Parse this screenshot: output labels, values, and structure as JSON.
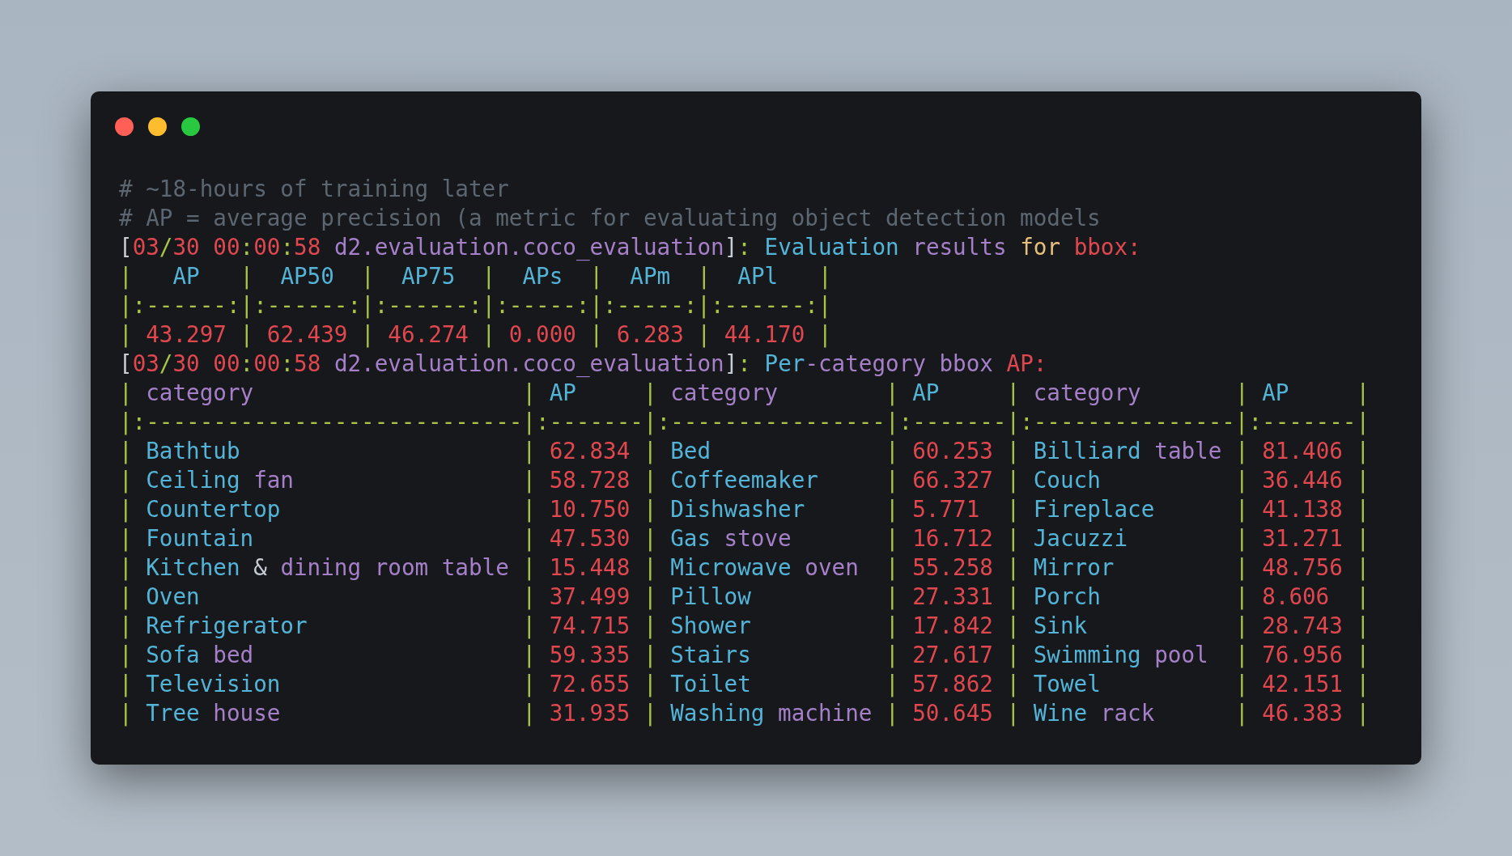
{
  "window": {
    "controls": [
      {
        "color": "#ff5f57"
      },
      {
        "color": "#febc2e"
      },
      {
        "color": "#28c840"
      }
    ]
  },
  "lines": [
    {
      "tokens": [
        {
          "text": "# ~18-hours of training later",
          "color": "#5c6671"
        }
      ]
    },
    {
      "tokens": [
        {
          "text": "# AP = average precision (a metric for evaluating object detection models",
          "color": "#5c6671"
        }
      ]
    },
    {
      "tokens": [
        {
          "text": "[",
          "color": "#c8ccd4"
        },
        {
          "text": "03",
          "color": "#e0474f"
        },
        {
          "text": "/",
          "color": "#a8c545"
        },
        {
          "text": "30 00",
          "color": "#e0474f"
        },
        {
          "text": ":",
          "color": "#a8c545"
        },
        {
          "text": "00",
          "color": "#e0474f"
        },
        {
          "text": ":",
          "color": "#a8c545"
        },
        {
          "text": "58",
          "color": "#e0474f"
        },
        {
          "text": " d2.evaluation.coco_evaluation",
          "color": "#a57fc8"
        },
        {
          "text": "]",
          "color": "#c8ccd4"
        },
        {
          "text": ": ",
          "color": "#a8c545"
        },
        {
          "text": "Evaluation",
          "color": "#53b4d8"
        },
        {
          "text": " results",
          "color": "#a57fc8"
        },
        {
          "text": " for",
          "color": "#e5c07b"
        },
        {
          "text": " bbox:",
          "color": "#e0474f"
        }
      ]
    },
    {
      "tokens": [
        {
          "text": "|   ",
          "color": "#a8c545"
        },
        {
          "text": "AP",
          "color": "#53b4d8"
        },
        {
          "text": "   |  ",
          "color": "#a8c545"
        },
        {
          "text": "AP50",
          "color": "#53b4d8"
        },
        {
          "text": "  |  ",
          "color": "#a8c545"
        },
        {
          "text": "AP75",
          "color": "#53b4d8"
        },
        {
          "text": "  |  ",
          "color": "#a8c545"
        },
        {
          "text": "APs",
          "color": "#53b4d8"
        },
        {
          "text": "  |  ",
          "color": "#a8c545"
        },
        {
          "text": "APm",
          "color": "#53b4d8"
        },
        {
          "text": "  |  ",
          "color": "#a8c545"
        },
        {
          "text": "APl",
          "color": "#53b4d8"
        },
        {
          "text": "   |",
          "color": "#a8c545"
        }
      ]
    },
    {
      "tokens": [
        {
          "text": "|:------:|:------:|:------:|:-----:|:-----:|:------:|",
          "color": "#a8c545"
        }
      ]
    },
    {
      "tokens": [
        {
          "text": "| ",
          "color": "#a8c545"
        },
        {
          "text": "43.297",
          "color": "#e0474f"
        },
        {
          "text": " | ",
          "color": "#a8c545"
        },
        {
          "text": "62.439",
          "color": "#e0474f"
        },
        {
          "text": " | ",
          "color": "#a8c545"
        },
        {
          "text": "46.274",
          "color": "#e0474f"
        },
        {
          "text": " | ",
          "color": "#a8c545"
        },
        {
          "text": "0.000",
          "color": "#e0474f"
        },
        {
          "text": " | ",
          "color": "#a8c545"
        },
        {
          "text": "6.283",
          "color": "#e0474f"
        },
        {
          "text": " | ",
          "color": "#a8c545"
        },
        {
          "text": "44.170",
          "color": "#e0474f"
        },
        {
          "text": " |",
          "color": "#a8c545"
        }
      ]
    },
    {
      "tokens": [
        {
          "text": "[",
          "color": "#c8ccd4"
        },
        {
          "text": "03",
          "color": "#e0474f"
        },
        {
          "text": "/",
          "color": "#a8c545"
        },
        {
          "text": "30 00",
          "color": "#e0474f"
        },
        {
          "text": ":",
          "color": "#a8c545"
        },
        {
          "text": "00",
          "color": "#e0474f"
        },
        {
          "text": ":",
          "color": "#a8c545"
        },
        {
          "text": "58",
          "color": "#e0474f"
        },
        {
          "text": " d2.evaluation.coco_evaluation",
          "color": "#a57fc8"
        },
        {
          "text": "]",
          "color": "#c8ccd4"
        },
        {
          "text": ": ",
          "color": "#a8c545"
        },
        {
          "text": "Per",
          "color": "#53b4d8"
        },
        {
          "text": "-category bbox",
          "color": "#a57fc8"
        },
        {
          "text": " AP:",
          "color": "#e0474f"
        }
      ]
    },
    {
      "tokens": [
        {
          "text": "| ",
          "color": "#a8c545"
        },
        {
          "text": "category",
          "color": "#a57fc8"
        },
        {
          "text": "                    | ",
          "color": "#a8c545"
        },
        {
          "text": "AP",
          "color": "#53b4d8"
        },
        {
          "text": "     | ",
          "color": "#a8c545"
        },
        {
          "text": "category",
          "color": "#a57fc8"
        },
        {
          "text": "        | ",
          "color": "#a8c545"
        },
        {
          "text": "AP",
          "color": "#53b4d8"
        },
        {
          "text": "     | ",
          "color": "#a8c545"
        },
        {
          "text": "category",
          "color": "#a57fc8"
        },
        {
          "text": "       | ",
          "color": "#a8c545"
        },
        {
          "text": "AP",
          "color": "#53b4d8"
        },
        {
          "text": "     |",
          "color": "#a8c545"
        }
      ]
    },
    {
      "tokens": [
        {
          "text": "|:----------------------------|:-------|:----------------|:-------|:---------------|:-------|",
          "color": "#a8c545"
        }
      ]
    },
    {
      "tokens": [
        {
          "text": "| ",
          "color": "#a8c545"
        },
        {
          "text": "Bathtub",
          "color": "#53b4d8"
        },
        {
          "text": "                     | ",
          "color": "#a8c545"
        },
        {
          "text": "62.834",
          "color": "#e0474f"
        },
        {
          "text": " | ",
          "color": "#a8c545"
        },
        {
          "text": "Bed",
          "color": "#53b4d8"
        },
        {
          "text": "             | ",
          "color": "#a8c545"
        },
        {
          "text": "60.253",
          "color": "#e0474f"
        },
        {
          "text": " | ",
          "color": "#a8c545"
        },
        {
          "text": "Billiard",
          "color": "#53b4d8"
        },
        {
          "text": " table",
          "color": "#a57fc8"
        },
        {
          "text": " | ",
          "color": "#a8c545"
        },
        {
          "text": "81.406",
          "color": "#e0474f"
        },
        {
          "text": " |",
          "color": "#a8c545"
        }
      ]
    },
    {
      "tokens": [
        {
          "text": "| ",
          "color": "#a8c545"
        },
        {
          "text": "Ceiling",
          "color": "#53b4d8"
        },
        {
          "text": " fan",
          "color": "#a57fc8"
        },
        {
          "text": "                 | ",
          "color": "#a8c545"
        },
        {
          "text": "58.728",
          "color": "#e0474f"
        },
        {
          "text": " | ",
          "color": "#a8c545"
        },
        {
          "text": "Coffeemaker",
          "color": "#53b4d8"
        },
        {
          "text": "     | ",
          "color": "#a8c545"
        },
        {
          "text": "66.327",
          "color": "#e0474f"
        },
        {
          "text": " | ",
          "color": "#a8c545"
        },
        {
          "text": "Couch",
          "color": "#53b4d8"
        },
        {
          "text": "          | ",
          "color": "#a8c545"
        },
        {
          "text": "36.446",
          "color": "#e0474f"
        },
        {
          "text": " |",
          "color": "#a8c545"
        }
      ]
    },
    {
      "tokens": [
        {
          "text": "| ",
          "color": "#a8c545"
        },
        {
          "text": "Countertop",
          "color": "#53b4d8"
        },
        {
          "text": "                  | ",
          "color": "#a8c545"
        },
        {
          "text": "10.750",
          "color": "#e0474f"
        },
        {
          "text": " | ",
          "color": "#a8c545"
        },
        {
          "text": "Dishwasher",
          "color": "#53b4d8"
        },
        {
          "text": "      | ",
          "color": "#a8c545"
        },
        {
          "text": "5.771",
          "color": "#e0474f"
        },
        {
          "text": "  | ",
          "color": "#a8c545"
        },
        {
          "text": "Fireplace",
          "color": "#53b4d8"
        },
        {
          "text": "      | ",
          "color": "#a8c545"
        },
        {
          "text": "41.138",
          "color": "#e0474f"
        },
        {
          "text": " |",
          "color": "#a8c545"
        }
      ]
    },
    {
      "tokens": [
        {
          "text": "| ",
          "color": "#a8c545"
        },
        {
          "text": "Fountain",
          "color": "#53b4d8"
        },
        {
          "text": "                    | ",
          "color": "#a8c545"
        },
        {
          "text": "47.530",
          "color": "#e0474f"
        },
        {
          "text": " | ",
          "color": "#a8c545"
        },
        {
          "text": "Gas",
          "color": "#53b4d8"
        },
        {
          "text": " stove",
          "color": "#a57fc8"
        },
        {
          "text": "       | ",
          "color": "#a8c545"
        },
        {
          "text": "16.712",
          "color": "#e0474f"
        },
        {
          "text": " | ",
          "color": "#a8c545"
        },
        {
          "text": "Jacuzzi",
          "color": "#53b4d8"
        },
        {
          "text": "        | ",
          "color": "#a8c545"
        },
        {
          "text": "31.271",
          "color": "#e0474f"
        },
        {
          "text": " |",
          "color": "#a8c545"
        }
      ]
    },
    {
      "tokens": [
        {
          "text": "| ",
          "color": "#a8c545"
        },
        {
          "text": "Kitchen",
          "color": "#53b4d8"
        },
        {
          "text": " & ",
          "color": "#c8ccd4"
        },
        {
          "text": "dining room table",
          "color": "#a57fc8"
        },
        {
          "text": " | ",
          "color": "#a8c545"
        },
        {
          "text": "15.448",
          "color": "#e0474f"
        },
        {
          "text": " | ",
          "color": "#a8c545"
        },
        {
          "text": "Microwave",
          "color": "#53b4d8"
        },
        {
          "text": " oven",
          "color": "#a57fc8"
        },
        {
          "text": "  | ",
          "color": "#a8c545"
        },
        {
          "text": "55.258",
          "color": "#e0474f"
        },
        {
          "text": " | ",
          "color": "#a8c545"
        },
        {
          "text": "Mirror",
          "color": "#53b4d8"
        },
        {
          "text": "         | ",
          "color": "#a8c545"
        },
        {
          "text": "48.756",
          "color": "#e0474f"
        },
        {
          "text": " |",
          "color": "#a8c545"
        }
      ]
    },
    {
      "tokens": [
        {
          "text": "| ",
          "color": "#a8c545"
        },
        {
          "text": "Oven",
          "color": "#53b4d8"
        },
        {
          "text": "                        | ",
          "color": "#a8c545"
        },
        {
          "text": "37.499",
          "color": "#e0474f"
        },
        {
          "text": " | ",
          "color": "#a8c545"
        },
        {
          "text": "Pillow",
          "color": "#53b4d8"
        },
        {
          "text": "          | ",
          "color": "#a8c545"
        },
        {
          "text": "27.331",
          "color": "#e0474f"
        },
        {
          "text": " | ",
          "color": "#a8c545"
        },
        {
          "text": "Porch",
          "color": "#53b4d8"
        },
        {
          "text": "          | ",
          "color": "#a8c545"
        },
        {
          "text": "8.606",
          "color": "#e0474f"
        },
        {
          "text": "  |",
          "color": "#a8c545"
        }
      ]
    },
    {
      "tokens": [
        {
          "text": "| ",
          "color": "#a8c545"
        },
        {
          "text": "Refrigerator",
          "color": "#53b4d8"
        },
        {
          "text": "                | ",
          "color": "#a8c545"
        },
        {
          "text": "74.715",
          "color": "#e0474f"
        },
        {
          "text": " | ",
          "color": "#a8c545"
        },
        {
          "text": "Shower",
          "color": "#53b4d8"
        },
        {
          "text": "          | ",
          "color": "#a8c545"
        },
        {
          "text": "17.842",
          "color": "#e0474f"
        },
        {
          "text": " | ",
          "color": "#a8c545"
        },
        {
          "text": "Sink",
          "color": "#53b4d8"
        },
        {
          "text": "           | ",
          "color": "#a8c545"
        },
        {
          "text": "28.743",
          "color": "#e0474f"
        },
        {
          "text": " |",
          "color": "#a8c545"
        }
      ]
    },
    {
      "tokens": [
        {
          "text": "| ",
          "color": "#a8c545"
        },
        {
          "text": "Sofa",
          "color": "#53b4d8"
        },
        {
          "text": " bed",
          "color": "#a57fc8"
        },
        {
          "text": "                    | ",
          "color": "#a8c545"
        },
        {
          "text": "59.335",
          "color": "#e0474f"
        },
        {
          "text": " | ",
          "color": "#a8c545"
        },
        {
          "text": "Stairs",
          "color": "#53b4d8"
        },
        {
          "text": "          | ",
          "color": "#a8c545"
        },
        {
          "text": "27.617",
          "color": "#e0474f"
        },
        {
          "text": " | ",
          "color": "#a8c545"
        },
        {
          "text": "Swimming",
          "color": "#53b4d8"
        },
        {
          "text": " pool",
          "color": "#a57fc8"
        },
        {
          "text": "  | ",
          "color": "#a8c545"
        },
        {
          "text": "76.956",
          "color": "#e0474f"
        },
        {
          "text": " |",
          "color": "#a8c545"
        }
      ]
    },
    {
      "tokens": [
        {
          "text": "| ",
          "color": "#a8c545"
        },
        {
          "text": "Television",
          "color": "#53b4d8"
        },
        {
          "text": "                  | ",
          "color": "#a8c545"
        },
        {
          "text": "72.655",
          "color": "#e0474f"
        },
        {
          "text": " | ",
          "color": "#a8c545"
        },
        {
          "text": "Toilet",
          "color": "#53b4d8"
        },
        {
          "text": "          | ",
          "color": "#a8c545"
        },
        {
          "text": "57.862",
          "color": "#e0474f"
        },
        {
          "text": " | ",
          "color": "#a8c545"
        },
        {
          "text": "Towel",
          "color": "#53b4d8"
        },
        {
          "text": "          | ",
          "color": "#a8c545"
        },
        {
          "text": "42.151",
          "color": "#e0474f"
        },
        {
          "text": " |",
          "color": "#a8c545"
        }
      ]
    },
    {
      "tokens": [
        {
          "text": "| ",
          "color": "#a8c545"
        },
        {
          "text": "Tree",
          "color": "#53b4d8"
        },
        {
          "text": " house",
          "color": "#a57fc8"
        },
        {
          "text": "                  | ",
          "color": "#a8c545"
        },
        {
          "text": "31.935",
          "color": "#e0474f"
        },
        {
          "text": " | ",
          "color": "#a8c545"
        },
        {
          "text": "Washing",
          "color": "#53b4d8"
        },
        {
          "text": " machine",
          "color": "#a57fc8"
        },
        {
          "text": " | ",
          "color": "#a8c545"
        },
        {
          "text": "50.645",
          "color": "#e0474f"
        },
        {
          "text": " | ",
          "color": "#a8c545"
        },
        {
          "text": "Wine",
          "color": "#53b4d8"
        },
        {
          "text": " rack",
          "color": "#a57fc8"
        },
        {
          "text": "      | ",
          "color": "#a8c545"
        },
        {
          "text": "46.383",
          "color": "#e0474f"
        },
        {
          "text": " |",
          "color": "#a8c545"
        }
      ]
    }
  ]
}
